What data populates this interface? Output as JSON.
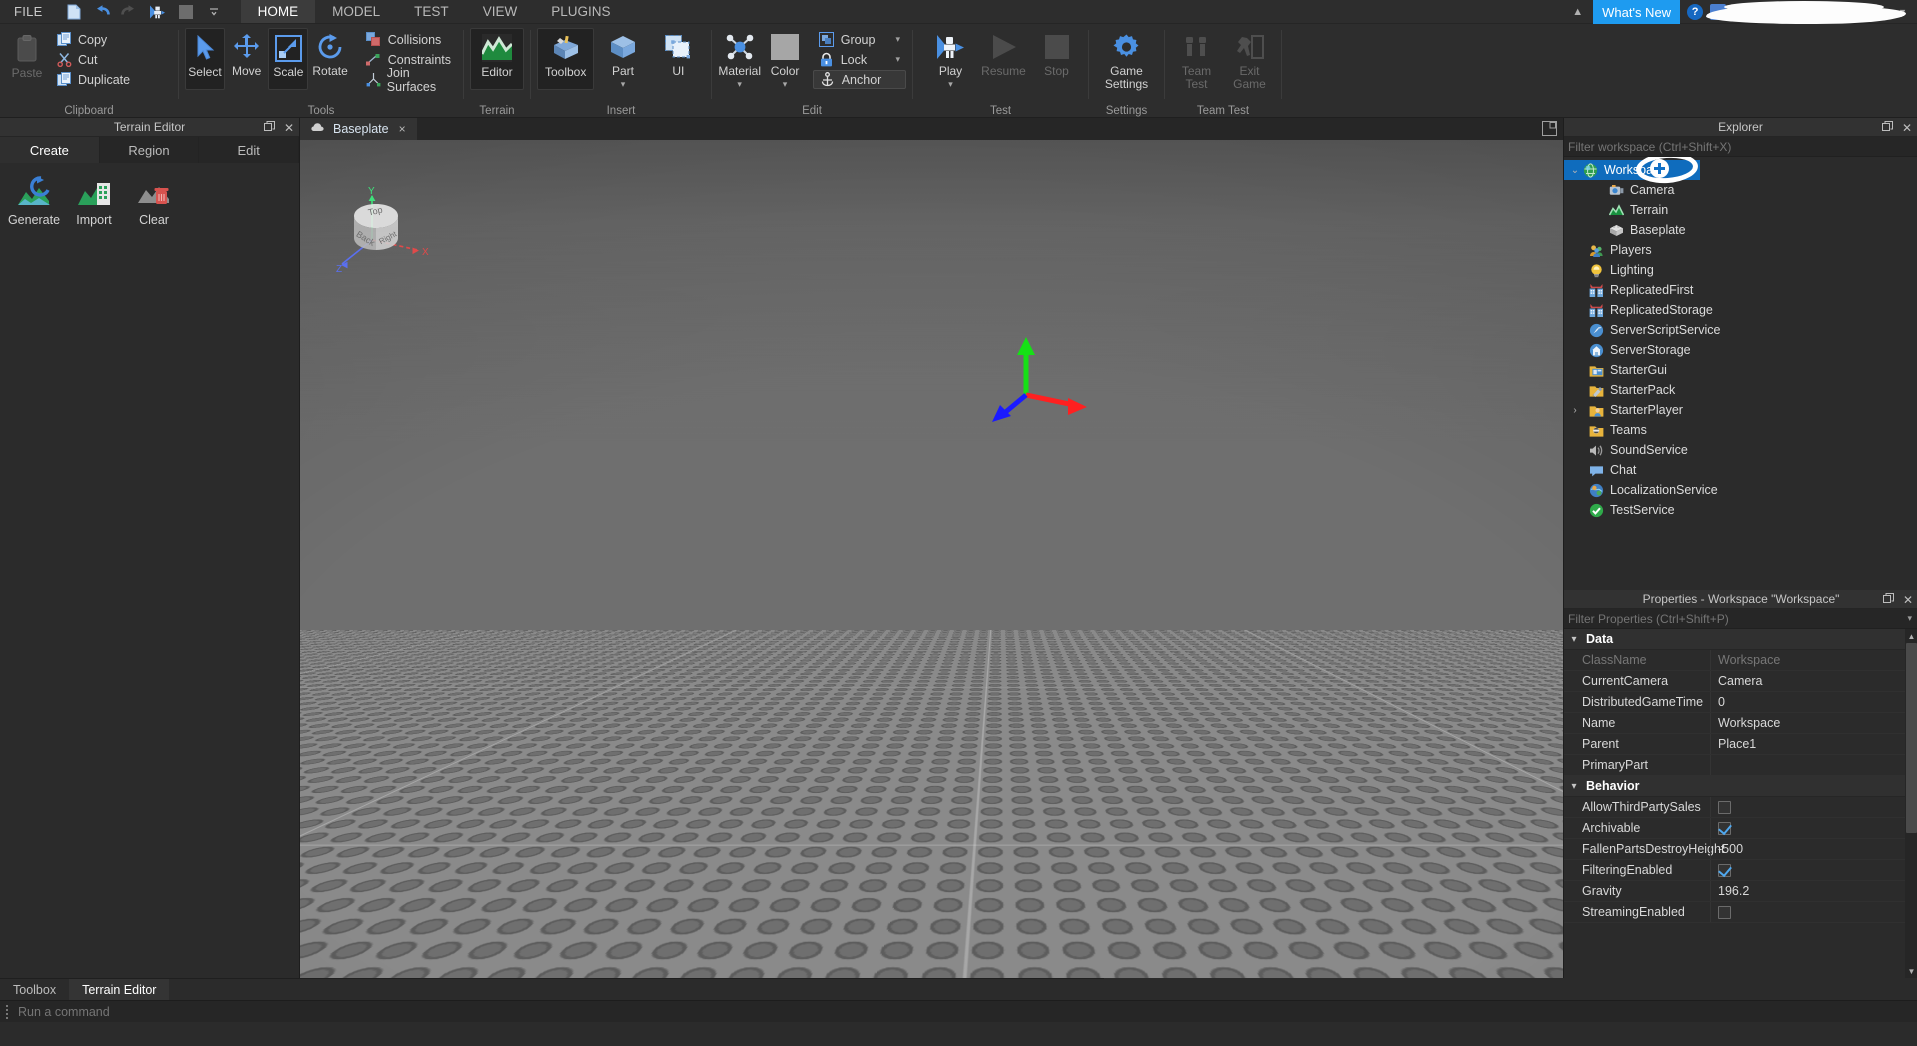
{
  "menubar": {
    "file_label": "FILE",
    "quick_access": [
      "new-document-icon",
      "undo-icon",
      "redo-icon",
      "play-figure-icon",
      "color-swatch-icon",
      "more-caret-icon"
    ],
    "tabs": [
      {
        "label": "HOME",
        "active": true
      },
      {
        "label": "MODEL",
        "active": false
      },
      {
        "label": "TEST",
        "active": false
      },
      {
        "label": "VIEW",
        "active": false
      },
      {
        "label": "PLUGINS",
        "active": false
      }
    ],
    "collapse_caret": "▲",
    "whats_new": "What's New",
    "help": "?",
    "account_name": "",
    "account_caret": "▼"
  },
  "ribbon": {
    "groups": [
      {
        "label": "Clipboard",
        "paste": {
          "label": "Paste",
          "icon": "clipboard-icon",
          "disabled": true
        },
        "items": [
          {
            "label": "Copy",
            "icon": "copy-icon",
            "disabled": false
          },
          {
            "label": "Cut",
            "icon": "scissors-icon",
            "disabled": false
          },
          {
            "label": "Duplicate",
            "icon": "duplicate-icon",
            "disabled": false
          }
        ]
      },
      {
        "label": "Tools",
        "big": [
          {
            "label": "Select",
            "icon": "cursor-arrow-icon",
            "framed": true
          },
          {
            "label": "Move",
            "icon": "move-arrows-icon",
            "framed": false
          },
          {
            "label": "Scale",
            "icon": "scale-icon",
            "framed": true
          },
          {
            "label": "Rotate",
            "icon": "rotate-icon",
            "framed": false
          }
        ],
        "items": [
          {
            "label": "Collisions",
            "icon": "collisions-icon"
          },
          {
            "label": "Constraints",
            "icon": "constraints-icon"
          },
          {
            "label": "Join Surfaces",
            "icon": "join-surfaces-icon"
          }
        ]
      },
      {
        "label": "Terrain",
        "big": [
          {
            "label": "Editor",
            "icon": "terrain-editor-icon",
            "framed": true
          }
        ]
      },
      {
        "label": "Insert",
        "big": [
          {
            "label": "Toolbox",
            "icon": "toolbox-icon",
            "framed": true
          },
          {
            "label": "Part",
            "icon": "part-cube-icon",
            "framed": false,
            "caret": true
          },
          {
            "label": "UI",
            "icon": "ui-frame-icon",
            "framed": false
          }
        ]
      },
      {
        "label": "Edit",
        "big": [
          {
            "label": "Material",
            "icon": "material-icon",
            "framed": false,
            "caret": true
          },
          {
            "label": "Color",
            "icon": "color-swatch-icon",
            "framed": false,
            "caret": true
          }
        ],
        "items": [
          {
            "label": "Group",
            "icon": "group-icon",
            "caret": true
          },
          {
            "label": "Lock",
            "icon": "lock-icon",
            "caret": true
          },
          {
            "label": "Anchor",
            "icon": "anchor-icon",
            "highlighted": true
          }
        ],
        "dialog_launcher": true
      },
      {
        "label": "Test",
        "big": [
          {
            "label": "Play",
            "icon": "play-figure-icon",
            "framed": false,
            "caret": true
          },
          {
            "label": "Resume",
            "icon": "resume-triangle-icon",
            "framed": false,
            "disabled": true
          },
          {
            "label": "Stop",
            "icon": "stop-square-icon",
            "framed": false,
            "disabled": true
          }
        ]
      },
      {
        "label": "Settings",
        "big": [
          {
            "label": "Game\nSettings",
            "line1": "Game",
            "line2": "Settings",
            "icon": "gear-icon",
            "framed": false
          }
        ]
      },
      {
        "label": "Team Test",
        "big": [
          {
            "label": "Team Test",
            "line1": "Team",
            "line2": "Test",
            "icon": "team-test-icon",
            "disabled": true
          },
          {
            "label": "Exit Game",
            "line1": "Exit",
            "line2": "Game",
            "icon": "exit-game-icon",
            "disabled": true
          }
        ]
      }
    ]
  },
  "terrain_editor": {
    "title": "Terrain Editor",
    "tabs": [
      {
        "label": "Create",
        "active": true
      },
      {
        "label": "Region",
        "active": false
      },
      {
        "label": "Edit",
        "active": false
      }
    ],
    "tools": [
      {
        "label": "Generate",
        "icon": "terrain-generate-icon"
      },
      {
        "label": "Import",
        "icon": "terrain-import-icon"
      },
      {
        "label": "Clear",
        "icon": "terrain-clear-icon"
      }
    ]
  },
  "bottom_tabs": [
    {
      "label": "Toolbox",
      "active": false
    },
    {
      "label": "Terrain Editor",
      "active": true
    }
  ],
  "command_bar": {
    "placeholder": "Run a command",
    "value": ""
  },
  "viewport": {
    "tab": {
      "label": "Baseplate",
      "icon": "baseplate-cloud-icon",
      "close": "×"
    },
    "view_cube": {
      "faces": [
        "Top",
        "Back",
        "Right"
      ],
      "axes": [
        "X",
        "Y",
        "Z"
      ]
    },
    "gizmo": {
      "type": "move-gizmo",
      "axis_colors": {
        "x": "#ff2020",
        "y": "#16e016",
        "z": "#1a1aff"
      }
    }
  },
  "explorer": {
    "title": "Explorer",
    "filter_placeholder": "Filter workspace (Ctrl+Shift+X)",
    "items": [
      {
        "label": "Workspace",
        "icon": "workspace-globe-icon",
        "indent": 1,
        "arrow": "⌄",
        "selected": true
      },
      {
        "label": "Camera",
        "icon": "camera-icon",
        "indent": 3,
        "arrow": "",
        "selected": false
      },
      {
        "label": "Terrain",
        "icon": "terrain-icon",
        "indent": 3,
        "arrow": "",
        "selected": false
      },
      {
        "label": "Baseplate",
        "icon": "part-icon",
        "indent": 3,
        "arrow": "",
        "selected": false
      },
      {
        "label": "Players",
        "icon": "players-icon",
        "indent": 2,
        "arrow": "",
        "selected": false
      },
      {
        "label": "Lighting",
        "icon": "lighting-bulb-icon",
        "indent": 2,
        "arrow": "",
        "selected": false
      },
      {
        "label": "ReplicatedFirst",
        "icon": "replicated-icon",
        "indent": 2,
        "arrow": "",
        "selected": false
      },
      {
        "label": "ReplicatedStorage",
        "icon": "replicated-icon",
        "indent": 2,
        "arrow": "",
        "selected": false
      },
      {
        "label": "ServerScriptService",
        "icon": "server-script-icon",
        "indent": 2,
        "arrow": "",
        "selected": false
      },
      {
        "label": "ServerStorage",
        "icon": "server-storage-icon",
        "indent": 2,
        "arrow": "",
        "selected": false
      },
      {
        "label": "StarterGui",
        "icon": "starter-gui-icon",
        "indent": 2,
        "arrow": "",
        "selected": false
      },
      {
        "label": "StarterPack",
        "icon": "starter-pack-icon",
        "indent": 2,
        "arrow": "",
        "selected": false
      },
      {
        "label": "StarterPlayer",
        "icon": "starter-player-icon",
        "indent": 2,
        "arrow": "›",
        "selected": false
      },
      {
        "label": "Teams",
        "icon": "teams-icon",
        "indent": 2,
        "arrow": "",
        "selected": false
      },
      {
        "label": "SoundService",
        "icon": "sound-service-icon",
        "indent": 2,
        "arrow": "",
        "selected": false
      },
      {
        "label": "Chat",
        "icon": "chat-bubble-icon",
        "indent": 2,
        "arrow": "",
        "selected": false
      },
      {
        "label": "LocalizationService",
        "icon": "localization-globe-icon",
        "indent": 2,
        "arrow": "",
        "selected": false
      },
      {
        "label": "TestService",
        "icon": "test-service-check-icon",
        "indent": 2,
        "arrow": "",
        "selected": false
      }
    ],
    "annotation": {
      "shape": "hand-drawn-circle",
      "badge": "plus-icon",
      "color": "#ffffff",
      "target": "Workspace"
    }
  },
  "properties": {
    "title": "Properties - Workspace \"Workspace\"",
    "filter_placeholder": "Filter Properties (Ctrl+Shift+P)",
    "groups": [
      {
        "name": "Data",
        "rows": [
          {
            "name": "ClassName",
            "value": "Workspace",
            "type": "text",
            "readonly": true
          },
          {
            "name": "CurrentCamera",
            "value": "Camera",
            "type": "text",
            "readonly": false
          },
          {
            "name": "DistributedGameTime",
            "value": "0",
            "type": "text",
            "readonly": false
          },
          {
            "name": "Name",
            "value": "Workspace",
            "type": "text",
            "readonly": false
          },
          {
            "name": "Parent",
            "value": "Place1",
            "type": "text",
            "readonly": false
          },
          {
            "name": "PrimaryPart",
            "value": "",
            "type": "text",
            "readonly": false
          }
        ]
      },
      {
        "name": "Behavior",
        "rows": [
          {
            "name": "AllowThirdPartySales",
            "value": "",
            "type": "checkbox",
            "checked": false
          },
          {
            "name": "Archivable",
            "value": "",
            "type": "checkbox",
            "checked": true
          },
          {
            "name": "FallenPartsDestroyHeight",
            "value": "-500",
            "type": "text",
            "readonly": false
          },
          {
            "name": "FilteringEnabled",
            "value": "",
            "type": "checkbox",
            "checked": true
          },
          {
            "name": "Gravity",
            "value": "196.2",
            "type": "text",
            "readonly": false
          },
          {
            "name": "StreamingEnabled",
            "value": "",
            "type": "checkbox",
            "checked": false
          }
        ]
      }
    ]
  },
  "colors": {
    "accent": "#1e9bf0",
    "selection": "#0f6cbd",
    "ribbon_bg": "#2d2d2d",
    "panel_bg": "#2b2b2b",
    "annotation": "#ffffff"
  }
}
